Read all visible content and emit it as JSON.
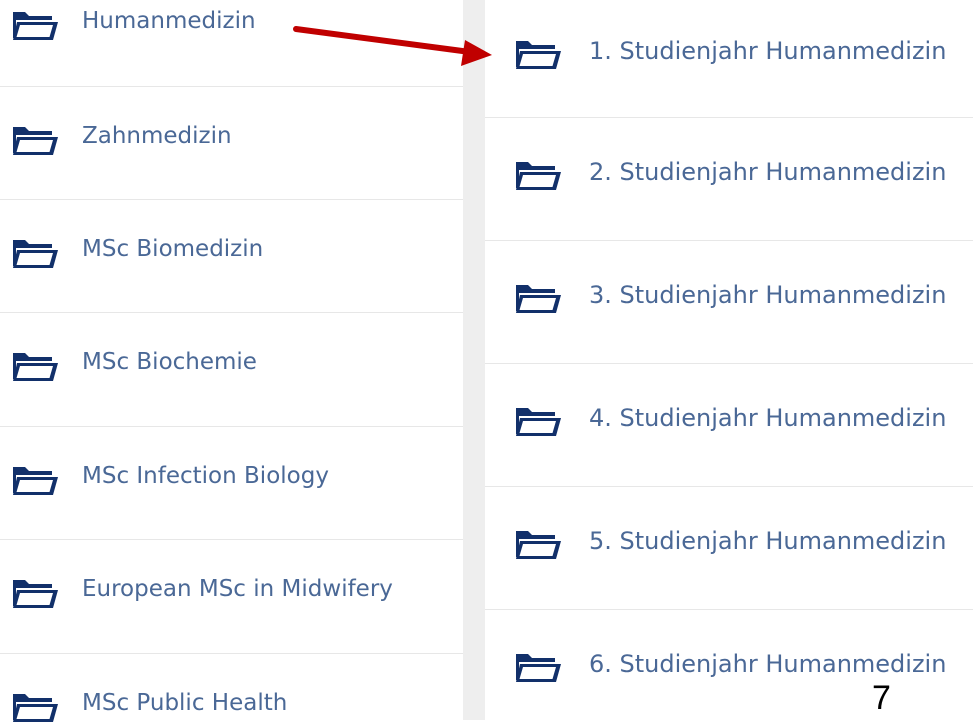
{
  "colors": {
    "folder_icon": "#12306a",
    "link_text": "#4a6896",
    "divider": "#e7e7e7",
    "gap": "#eeeeee",
    "arrow": "#c00000"
  },
  "icons": {
    "folder": "folder-open-icon"
  },
  "left_list": {
    "items": [
      {
        "label": "Humanmedizin"
      },
      {
        "label": "Zahnmedizin"
      },
      {
        "label": "MSc Biomedizin"
      },
      {
        "label": "MSc Biochemie"
      },
      {
        "label": "MSc Infection Biology"
      },
      {
        "label": "European MSc in Midwifery"
      },
      {
        "label": "MSc Public Health"
      }
    ]
  },
  "right_list": {
    "items": [
      {
        "label": "1. Studienjahr Humanmedizin"
      },
      {
        "label": "2. Studienjahr Humanmedizin"
      },
      {
        "label": "3. Studienjahr Humanmedizin"
      },
      {
        "label": "4. Studienjahr Humanmedizin"
      },
      {
        "label": "5. Studienjahr Humanmedizin"
      },
      {
        "label": "6. Studienjahr Humanmedizin"
      }
    ]
  },
  "page_number": "7"
}
